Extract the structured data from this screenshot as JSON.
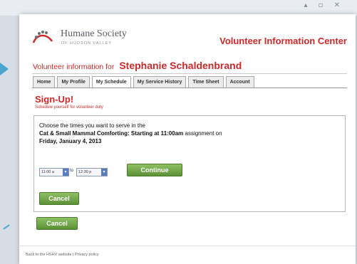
{
  "logo": {
    "name": "Humane Society",
    "subtitle": "OF HUDSON VALLEY"
  },
  "header": {
    "title": "Volunteer Information Center",
    "welcome_prefix": "Volunteer information for",
    "volunteer_name": "Stephanie Schaldenbrand"
  },
  "tabs": [
    {
      "label": "Home",
      "active": false
    },
    {
      "label": "My Profile",
      "active": false
    },
    {
      "label": "My Schedule",
      "active": true
    },
    {
      "label": "My Service History",
      "active": false
    },
    {
      "label": "Time Sheet",
      "active": false
    },
    {
      "label": "Account",
      "active": false
    }
  ],
  "signup": {
    "heading": "Sign-Up!",
    "subheading": "Schedule yourself for volunteer duty",
    "instruction": "Choose the times you want to serve in the",
    "assignment": "Cat & Small Mammal Comforting: Starting at 11:00am",
    "assignment_suffix": "assignment on",
    "date": "Friday, January 4, 2013",
    "start_time": "11:00 a",
    "to_label": "to",
    "end_time": "12:30 p",
    "continue_label": "Continue",
    "cancel_label": "Cancel"
  },
  "outer_cancel_label": "Cancel",
  "footer": {
    "text": "Back to the HSHV website | Privacy policy"
  },
  "colors": {
    "accent_red": "#cc2a2a",
    "button_green": "#6ea845",
    "arrow_blue": "#4aa6cc"
  }
}
